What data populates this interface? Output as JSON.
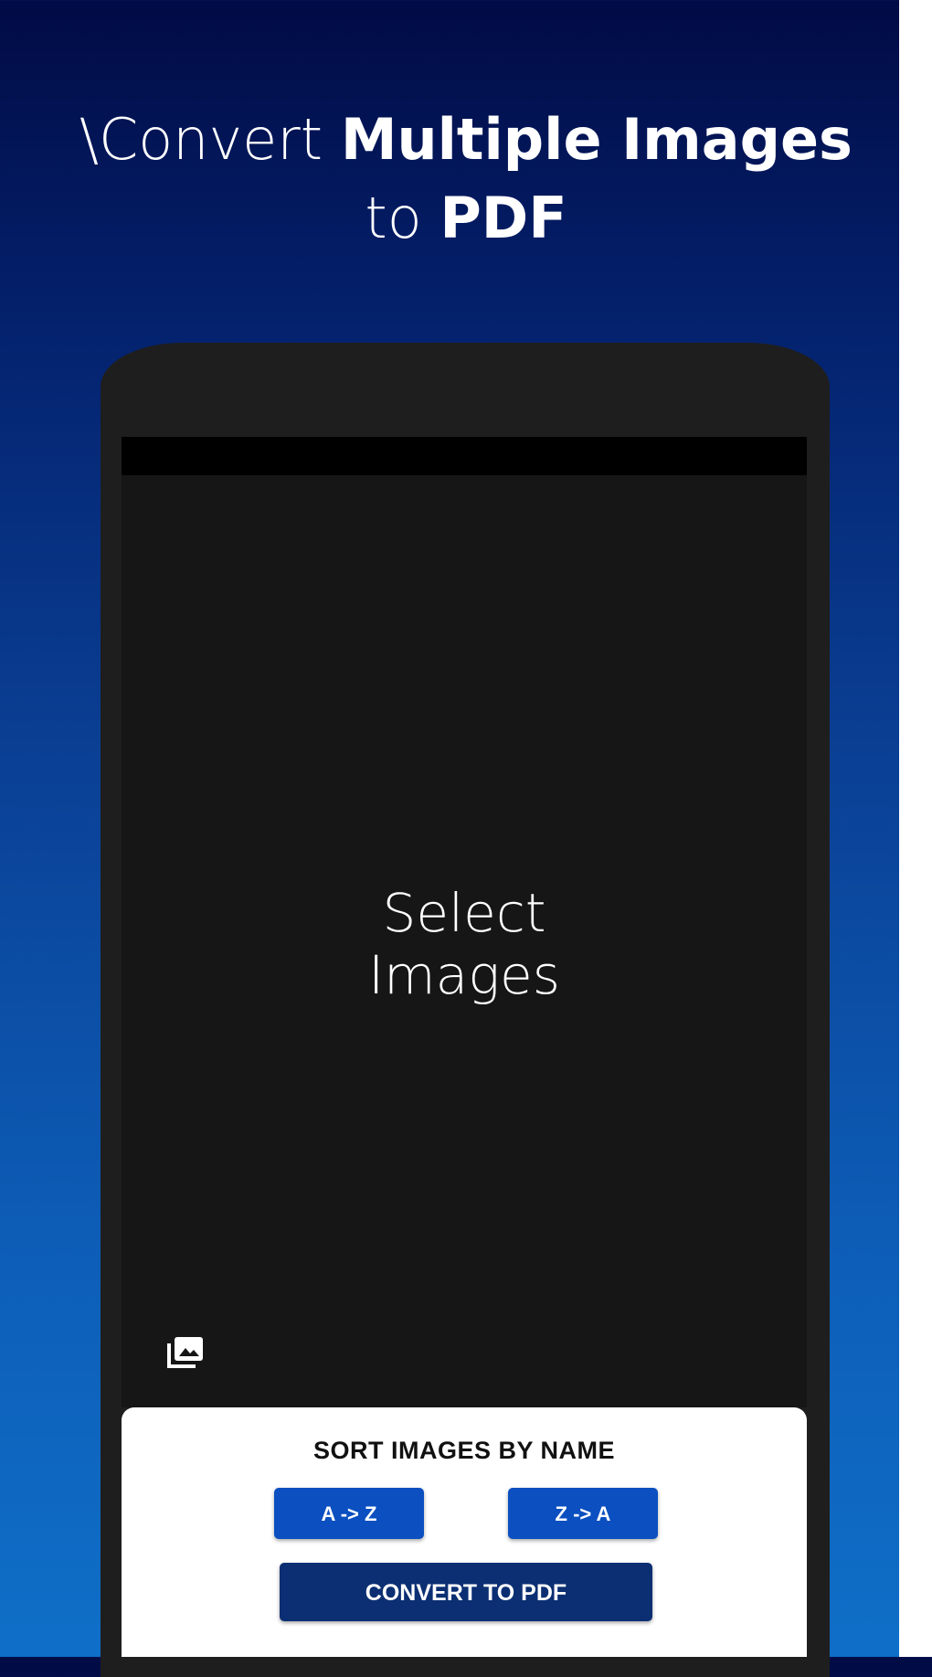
{
  "headline": {
    "line1_prefix": "\\Convert ",
    "line1_bold": "Multiple Images",
    "line2_prefix": "to ",
    "line2_bold": "PDF"
  },
  "screen": {
    "placeholder_line1": "Select",
    "placeholder_line2": "Images",
    "gallery_icon": "photo-library-icon"
  },
  "sort_panel": {
    "title": "SORT IMAGES BY NAME",
    "az_label": "A -> Z",
    "za_label": "Z -> A",
    "convert_label": "CONVERT TO PDF"
  },
  "colors": {
    "background_top": "#010b45",
    "background_bottom": "#0f6fc8",
    "sort_button": "#0b4fc0",
    "convert_button": "#0b2f72"
  }
}
